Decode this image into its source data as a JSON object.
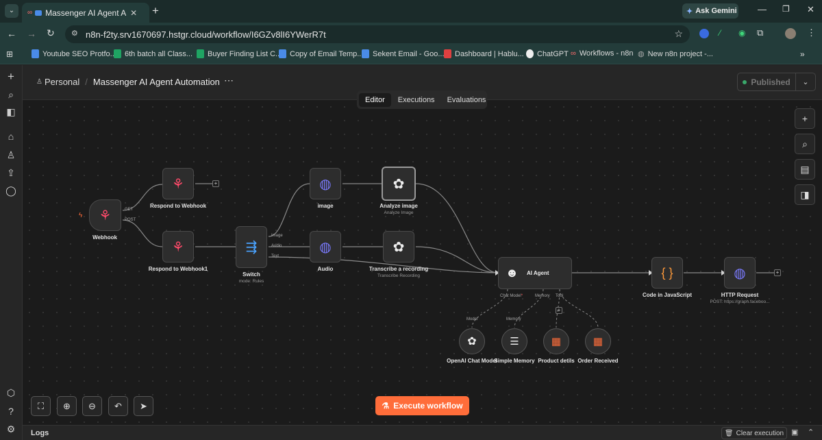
{
  "browser": {
    "tab_title": "Massenger AI Agent Automatio",
    "ask_gemini": "Ask Gemini",
    "url": "n8n-f2ty.srv1670697.hstgr.cloud/workflow/I6GZv8lI6YWerR7t"
  },
  "bookmarks": [
    "Youtube SEO Protfo...",
    "6th batch all Class...",
    "Buyer Finding List C...",
    "Copy of Email Temp...",
    "Sekent Email - Goo...",
    "Dashboard | Hablu...",
    "ChatGPT",
    "Workflows - n8n",
    "New n8n project -..."
  ],
  "header": {
    "project": "Personal",
    "separator": "/",
    "workflow_name": "Massenger AI Agent Automation",
    "more": "⋯",
    "published": "Published",
    "tabs": [
      "Editor",
      "Executions",
      "Evaluations"
    ]
  },
  "nodes": {
    "webhook": {
      "label": "Webhook",
      "port_get": "GET",
      "port_post": "POST"
    },
    "respond1": {
      "label": "Respond to Webhook"
    },
    "respond2": {
      "label": "Respond to Webhook1"
    },
    "switch": {
      "label": "Switch",
      "sub": "mode: Rules",
      "out_image": "Image",
      "out_audio": "Audio",
      "out_text": "Text"
    },
    "image": {
      "label": "image"
    },
    "audio": {
      "label": "Audio"
    },
    "analyze": {
      "label": "Analyze image",
      "sub": "Analyze Image"
    },
    "transcribe": {
      "label": "Transcribe a recording",
      "sub": "Transcribe Recording"
    },
    "agent": {
      "label": "AI Agent",
      "port_model": "Chat Model",
      "port_model_req": "*",
      "port_memory": "Memory",
      "port_tool": "Tool"
    },
    "code": {
      "label": "Code in JavaScript"
    },
    "http": {
      "label": "HTTP Request",
      "sub": "POST: https://graph.faceboo..."
    },
    "openai": {
      "label": "OpenAI Chat Model",
      "conn": "Model"
    },
    "memory": {
      "label": "Simple Memory",
      "conn": "Memory"
    },
    "product": {
      "label": "Product detils"
    },
    "order": {
      "label": "Order Received"
    }
  },
  "execute_label": "Execute workflow",
  "logs_label": "Logs",
  "clear_execution": "Clear execution",
  "colors": {
    "accent": "#ff6d3a",
    "webhook": "#ff4a6a",
    "openai": "#e8e8e8",
    "globe": "#7b7bff",
    "table": "#ff6d3a"
  }
}
